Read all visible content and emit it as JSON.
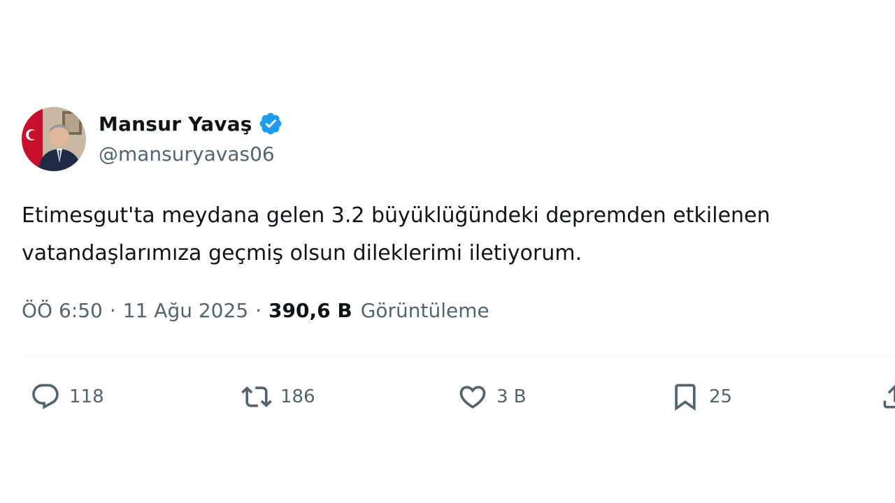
{
  "author": {
    "display_name": "Mansur Yavaş",
    "handle": "@mansuryavas06",
    "verified": true
  },
  "tweet": {
    "text": "Etimesgut'ta meydana gelen 3.2 büyüklüğündeki depremden etkilenen vatandaşlarımıza geçmiş olsun dileklerimi iletiyorum."
  },
  "meta": {
    "time": "ÖÖ 6:50",
    "separator": "·",
    "date": "11 Ağu 2025",
    "views_count": "390,6 B",
    "views_label": "Görüntüleme"
  },
  "actions": {
    "replies": "118",
    "retweets": "186",
    "likes": "3 B",
    "bookmarks": "25"
  },
  "icons": {
    "verified": "verified-badge-icon",
    "reply": "reply-icon",
    "retweet": "retweet-icon",
    "like": "heart-icon",
    "bookmark": "bookmark-icon",
    "share": "share-icon"
  },
  "colors": {
    "accent": "#1d9bf0",
    "text_primary": "#0f1419",
    "text_secondary": "#536471",
    "divider": "#eff3f4"
  }
}
